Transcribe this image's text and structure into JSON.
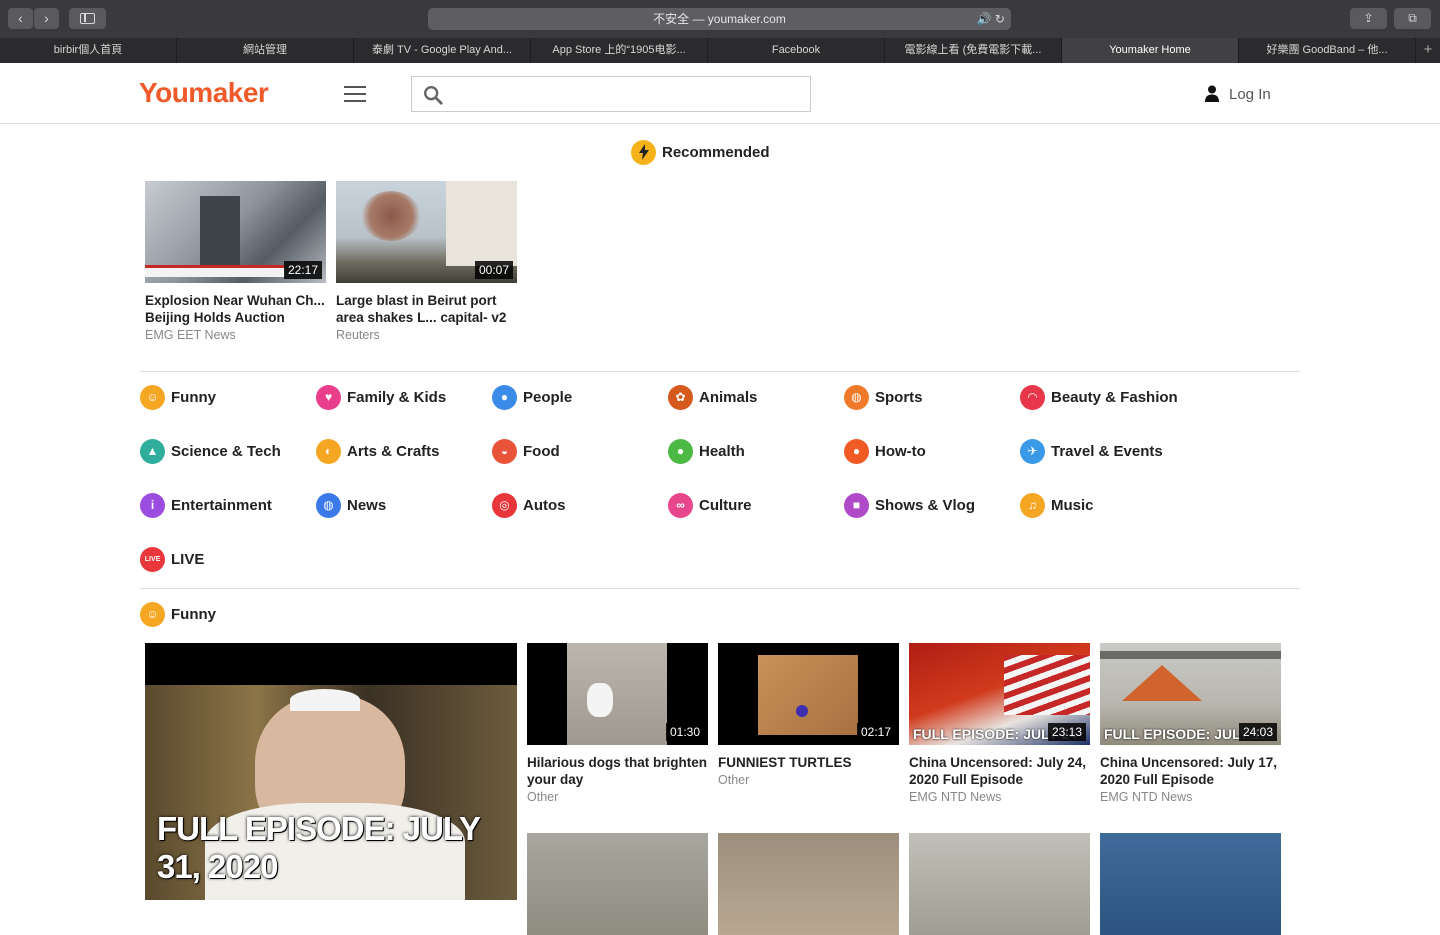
{
  "browser": {
    "address": "不安全 — youmaker.com",
    "tabs": [
      {
        "label": "birbir個人首頁",
        "active": false
      },
      {
        "label": "網站管理",
        "active": false
      },
      {
        "label": "泰劇 TV - Google Play And...",
        "active": false
      },
      {
        "label": "App Store 上的“1905电影...",
        "active": false
      },
      {
        "label": "Facebook",
        "active": false
      },
      {
        "label": "電影線上看 (免費電影下載...",
        "active": false
      },
      {
        "label": "Youmaker Home",
        "active": true
      },
      {
        "label": "好樂團 GoodBand – 他...",
        "active": false
      }
    ]
  },
  "header": {
    "logo": "Youmaker",
    "search_placeholder": "",
    "login": "Log In"
  },
  "recommended": {
    "title": "Recommended",
    "videos": [
      {
        "title": "Explosion Near Wuhan Ch... Beijing Holds Auction",
        "channel": "EMG EET News",
        "duration": "22:17"
      },
      {
        "title": "Large blast in Beirut port area shakes L... capital- v2",
        "channel": "Reuters",
        "duration": "00:07"
      }
    ]
  },
  "categories": [
    {
      "label": "Funny",
      "icon": "smile-icon",
      "color": "#f5a623"
    },
    {
      "label": "Family & Kids",
      "icon": "heart-icon",
      "color": "#e83e8c"
    },
    {
      "label": "People",
      "icon": "people-icon",
      "color": "#3b8be8"
    },
    {
      "label": "Animals",
      "icon": "paw-icon",
      "color": "#d65a1e"
    },
    {
      "label": "Sports",
      "icon": "ball-icon",
      "color": "#f07a2a"
    },
    {
      "label": "Beauty & Fashion",
      "icon": "lips-icon",
      "color": "#e8364a"
    },
    {
      "label": "Science & Tech",
      "icon": "flask-icon",
      "color": "#2fae9e"
    },
    {
      "label": "Arts & Crafts",
      "icon": "palette-icon",
      "color": "#f5a623"
    },
    {
      "label": "Food",
      "icon": "food-icon",
      "color": "#e8533a"
    },
    {
      "label": "Health",
      "icon": "apple-icon",
      "color": "#4cb944"
    },
    {
      "label": "How-to",
      "icon": "bulb-icon",
      "color": "#f05a24"
    },
    {
      "label": "Travel & Events",
      "icon": "plane-icon",
      "color": "#3b9ae8"
    },
    {
      "label": "Entertainment",
      "icon": "info-icon",
      "color": "#9b4de0"
    },
    {
      "label": "News",
      "icon": "globe-icon",
      "color": "#3b7ae8"
    },
    {
      "label": "Autos",
      "icon": "wheel-icon",
      "color": "#e8363a"
    },
    {
      "label": "Culture",
      "icon": "glasses-icon",
      "color": "#e8468c"
    },
    {
      "label": "Shows & Vlog",
      "icon": "camera-icon",
      "color": "#b04ac8"
    },
    {
      "label": "Music",
      "icon": "music-icon",
      "color": "#f5a623"
    },
    {
      "label": "LIVE",
      "icon": "live-icon",
      "color": "#e8363a"
    }
  ],
  "live_badge": "LIVE",
  "funny": {
    "title": "Funny",
    "featured_caption": "FULL EPISODE: JULY 31, 2020",
    "videos": [
      {
        "title": "Hilarious dogs that brighten your day",
        "channel": "Other",
        "duration": "01:30"
      },
      {
        "title": "FUNNIEST TURTLES",
        "channel": "Other",
        "duration": "02:17"
      },
      {
        "title": "China Uncensored: July 24, 2020 Full Episode",
        "channel": "EMG NTD News",
        "duration": "23:13",
        "caption": "FULL EPISODE: JULY 24"
      },
      {
        "title": "China Uncensored: July 17, 2020 Full Episode",
        "channel": "EMG NTD News",
        "duration": "24:03",
        "caption": "FULL EPISODE: JULY 17"
      }
    ]
  }
}
